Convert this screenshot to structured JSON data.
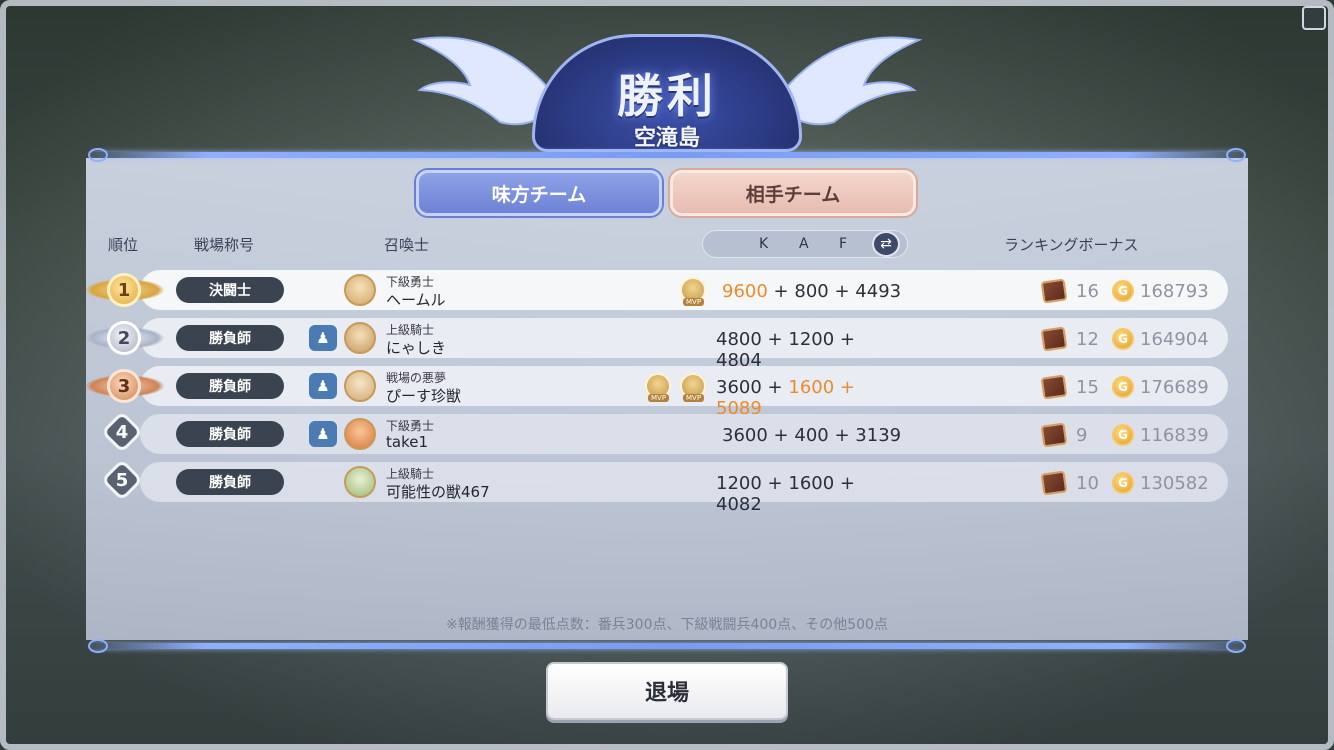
{
  "header": {
    "title": "勝利",
    "subtitle": "空滝島"
  },
  "tabs": {
    "ally": "味方チーム",
    "enemy": "相手チーム"
  },
  "columns": {
    "rank": "順位",
    "title": "戦場称号",
    "summoner": "召喚士",
    "k": "K",
    "a": "A",
    "f": "F",
    "bonus": "ランキングボーナス"
  },
  "rows": [
    {
      "rank": "1",
      "title": "決闘士",
      "player_rank": "下級勇士",
      "player_name": "ヘームル",
      "k": "9600",
      "a": "800",
      "f": "4493",
      "chests": "16",
      "coins": "168793"
    },
    {
      "rank": "2",
      "title": "勝負師",
      "player_rank": "上級騎士",
      "player_name": "にゃしき",
      "k": "4800",
      "a": "1200",
      "f": "4804",
      "chests": "12",
      "coins": "164904"
    },
    {
      "rank": "3",
      "title": "勝負師",
      "player_rank": "戦場の悪夢",
      "player_name": "ぴーす珍獣",
      "k": "3600",
      "a": "1600",
      "f": "5089",
      "chests": "15",
      "coins": "176689"
    },
    {
      "rank": "4",
      "title": "勝負師",
      "player_rank": "下級勇士",
      "player_name": "take1",
      "k": "3600",
      "a": "400",
      "f": "3139",
      "chests": "9",
      "coins": "116839"
    },
    {
      "rank": "5",
      "title": "勝負師",
      "player_rank": "上級騎士",
      "player_name": "可能性の獣467",
      "k": "1200",
      "a": "1600",
      "f": "4082",
      "chests": "10",
      "coins": "130582"
    }
  ],
  "score_plus": "+",
  "mvp_label": "MVP",
  "footnote": "※報酬獲得の最低点数：番兵300点、下級戦闘兵400点、その他500点",
  "exit_label": "退場",
  "colors": {
    "highlight": "#ee8a2c",
    "ally_tab": "#7d90dc",
    "enemy_tab": "#eccac0",
    "title_pill": "#3c4350"
  }
}
